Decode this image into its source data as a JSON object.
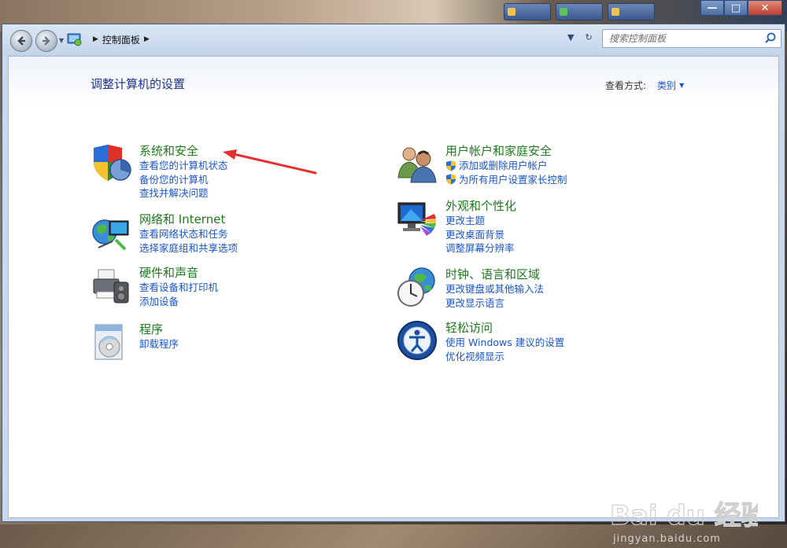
{
  "window": {
    "controls": {
      "minimize": "—",
      "maximize": "□",
      "close": "✕"
    }
  },
  "navbar": {
    "breadcrumb": [
      "控制面板"
    ],
    "search_placeholder": "搜索控制面板",
    "refresh_symbol": "↻"
  },
  "main": {
    "title": "调整计算机的设置",
    "view_by_label": "查看方式:",
    "view_by_value": "类别"
  },
  "categories": [
    {
      "id": "system-security",
      "title": "系统和安全",
      "icon": "shield-chart-icon",
      "links": [
        {
          "label": "查看您的计算机状态",
          "shield": false
        },
        {
          "label": "备份您的计算机",
          "shield": false
        },
        {
          "label": "查找并解决问题",
          "shield": false
        }
      ]
    },
    {
      "id": "network-internet",
      "title": "网络和 Internet",
      "icon": "globe-network-icon",
      "links": [
        {
          "label": "查看网络状态和任务",
          "shield": false
        },
        {
          "label": "选择家庭组和共享选项",
          "shield": false
        }
      ]
    },
    {
      "id": "hardware-sound",
      "title": "硬件和声音",
      "icon": "printer-speaker-icon",
      "links": [
        {
          "label": "查看设备和打印机",
          "shield": false
        },
        {
          "label": "添加设备",
          "shield": false
        }
      ]
    },
    {
      "id": "programs",
      "title": "程序",
      "icon": "program-disc-icon",
      "links": [
        {
          "label": "卸载程序",
          "shield": false
        }
      ]
    },
    {
      "id": "user-accounts",
      "title": "用户帐户和家庭安全",
      "icon": "users-icon",
      "links": [
        {
          "label": "添加或删除用户帐户",
          "shield": true
        },
        {
          "label": "为所有用户设置家长控制",
          "shield": true
        }
      ]
    },
    {
      "id": "appearance",
      "title": "外观和个性化",
      "icon": "monitor-palette-icon",
      "links": [
        {
          "label": "更改主题",
          "shield": false
        },
        {
          "label": "更改桌面背景",
          "shield": false
        },
        {
          "label": "调整屏幕分辨率",
          "shield": false
        }
      ]
    },
    {
      "id": "clock-language",
      "title": "时钟、语言和区域",
      "icon": "clock-globe-icon",
      "links": [
        {
          "label": "更改键盘或其他输入法",
          "shield": false
        },
        {
          "label": "更改显示语言",
          "shield": false
        }
      ]
    },
    {
      "id": "ease-of-access",
      "title": "轻松访问",
      "icon": "ease-of-access-icon",
      "links": [
        {
          "label": "使用 Windows 建议的设置",
          "shield": false
        },
        {
          "label": "优化视频显示",
          "shield": false
        }
      ]
    }
  ],
  "watermark": {
    "brand": "Bai du 经验",
    "url": "jingyan.baidu.com"
  },
  "colors": {
    "category_title": "#1e7a1e",
    "link": "#1a55c8",
    "page_title": "#1e3287",
    "annotation_arrow": "#e53030"
  }
}
